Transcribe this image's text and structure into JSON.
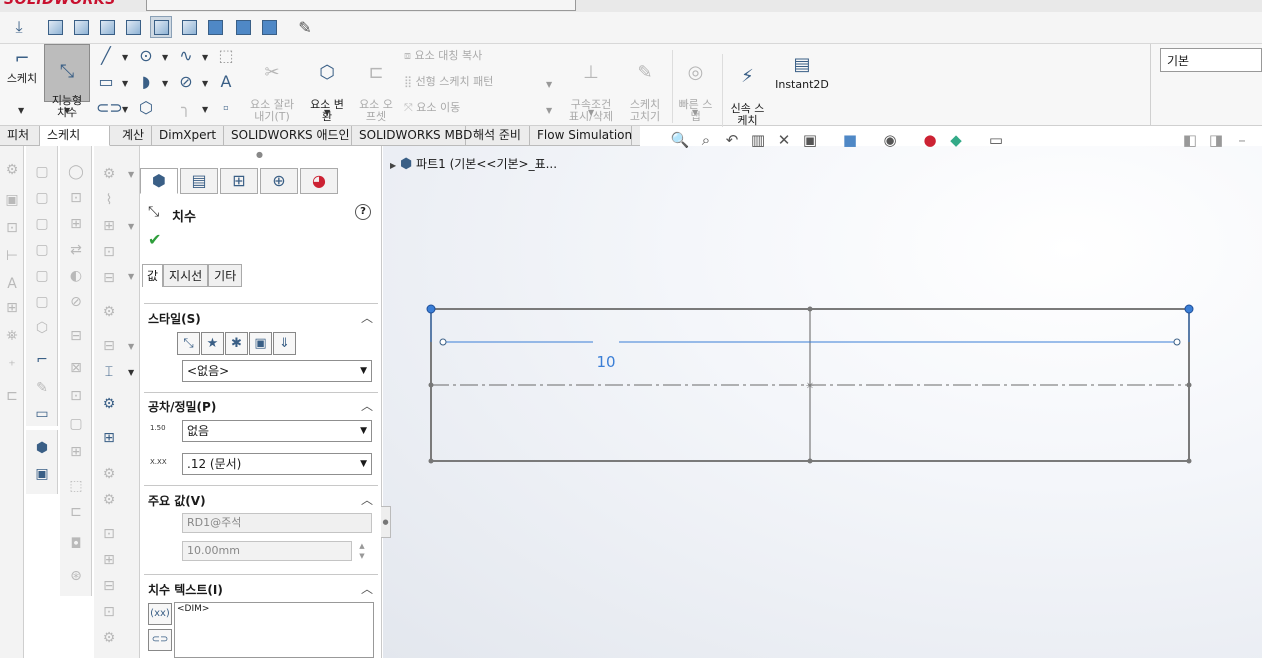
{
  "app": {
    "logo": "SOLIDWORKS"
  },
  "command_manager": {
    "sketch": "스케치",
    "smart_dim": "지능형\n치수",
    "trim": "요소 잘라\n내기(T)",
    "convert": "요소 변\n환",
    "offset": "요소 오\n프셋",
    "mirror": "요소 대칭 복사",
    "linear_pattern": "선형 스케치 패턴",
    "move": "요소 이동",
    "relations": "구속조건\n표시/삭제",
    "repair": "스케치\n고치기",
    "quick_snap": "빠른 스\n냅",
    "rapid_sketch": "신속 스\n케치",
    "instant2d": "Instant2D"
  },
  "configuration": "기본",
  "tabs": [
    "피처",
    "스케치",
    "계산",
    "DimXpert",
    "SOLIDWORKS 애드인",
    "SOLIDWORKS MBD",
    "해석 준비",
    "Flow Simulation"
  ],
  "active_tab": "스케치",
  "tree": {
    "part": "파트1  (기본<<기본>_표..."
  },
  "property_manager": {
    "title": "치수",
    "help": "?",
    "subtabs": [
      "값",
      "지시선",
      "기타"
    ],
    "style": {
      "title": "스타일(S)",
      "value": "<없음>"
    },
    "tolerance": {
      "title": "공차/정밀(P)",
      "tol_type": "없음",
      "precision": ".12 (문서)",
      "tol_icon": "1.50",
      "prec_icon": "X.XX"
    },
    "primary": {
      "title": "주요 값(V)",
      "name": "RD1@주석",
      "value": "10.00mm"
    },
    "dim_text": {
      "title": "치수 텍스트(I)",
      "content": "<DIM>"
    }
  },
  "sketch": {
    "dimension": "10"
  }
}
